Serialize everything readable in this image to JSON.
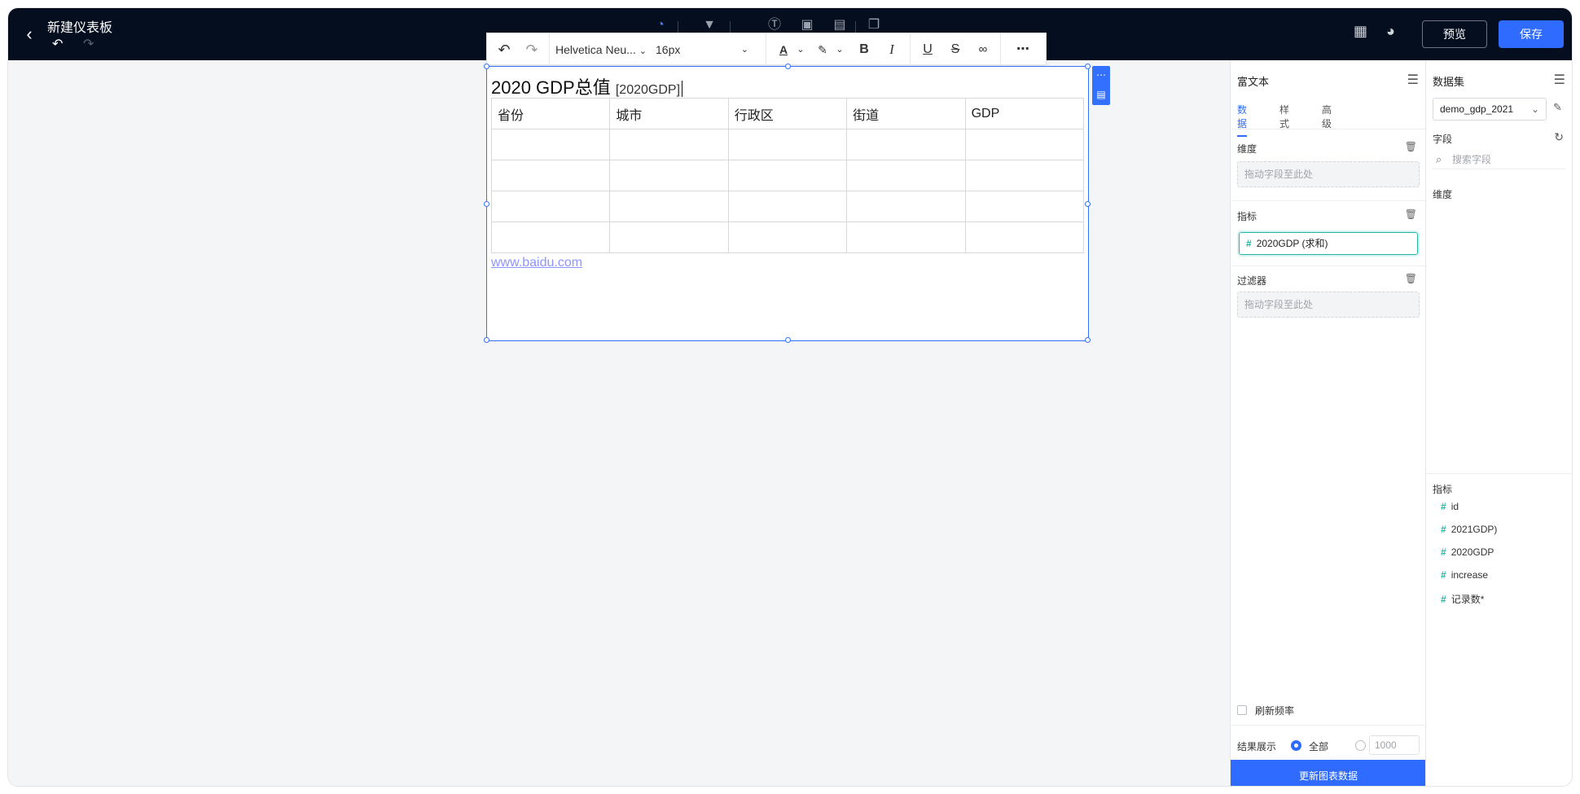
{
  "header": {
    "title": "新建仪表板",
    "preview_label": "预览",
    "save_label": "保存"
  },
  "editor_toolbar": {
    "font_family": "Helvetica Neu...",
    "font_size": "16px"
  },
  "component": {
    "title_text": "2020 GDP总值",
    "title_field": "[2020GDP]",
    "table_headers": [
      "省份",
      "城市",
      "行政区",
      "街道",
      "GDP"
    ],
    "table_rows": [
      [
        "",
        "",
        "",
        "",
        ""
      ],
      [
        "",
        "",
        "",
        "",
        ""
      ],
      [
        "",
        "",
        "",
        "",
        ""
      ],
      [
        "",
        "",
        "",
        "",
        ""
      ]
    ],
    "link_text": "www.baidu.com"
  },
  "rich_text_panel": {
    "title": "富文本",
    "tabs": [
      "数据",
      "样式",
      "高级"
    ],
    "active_tab": "数据",
    "dimension_label": "维度",
    "dimension_placeholder": "拖动字段至此处",
    "metric_label": "指标",
    "metric_value": "2020GDP (求和)",
    "filter_label": "过滤器",
    "filter_placeholder": "拖动字段至此处",
    "refresh_label": "刷新频率",
    "result_label": "结果展示",
    "result_all_label": "全部",
    "result_limit_value": "1000",
    "update_button": "更新图表数据"
  },
  "dataset_panel": {
    "title": "数据集",
    "dataset_name": "demo_gdp_2021",
    "fields_label": "字段",
    "search_placeholder": "搜索字段",
    "dimension_label": "维度",
    "metric_label": "指标",
    "metrics": [
      "id",
      "2021GDP)",
      "2020GDP",
      "increase",
      "记录数*"
    ]
  },
  "colors": {
    "topbar": "#050e1f",
    "accent": "#2f6bff",
    "metric_teal": "#26b5a4",
    "link": "#8f95ff"
  }
}
